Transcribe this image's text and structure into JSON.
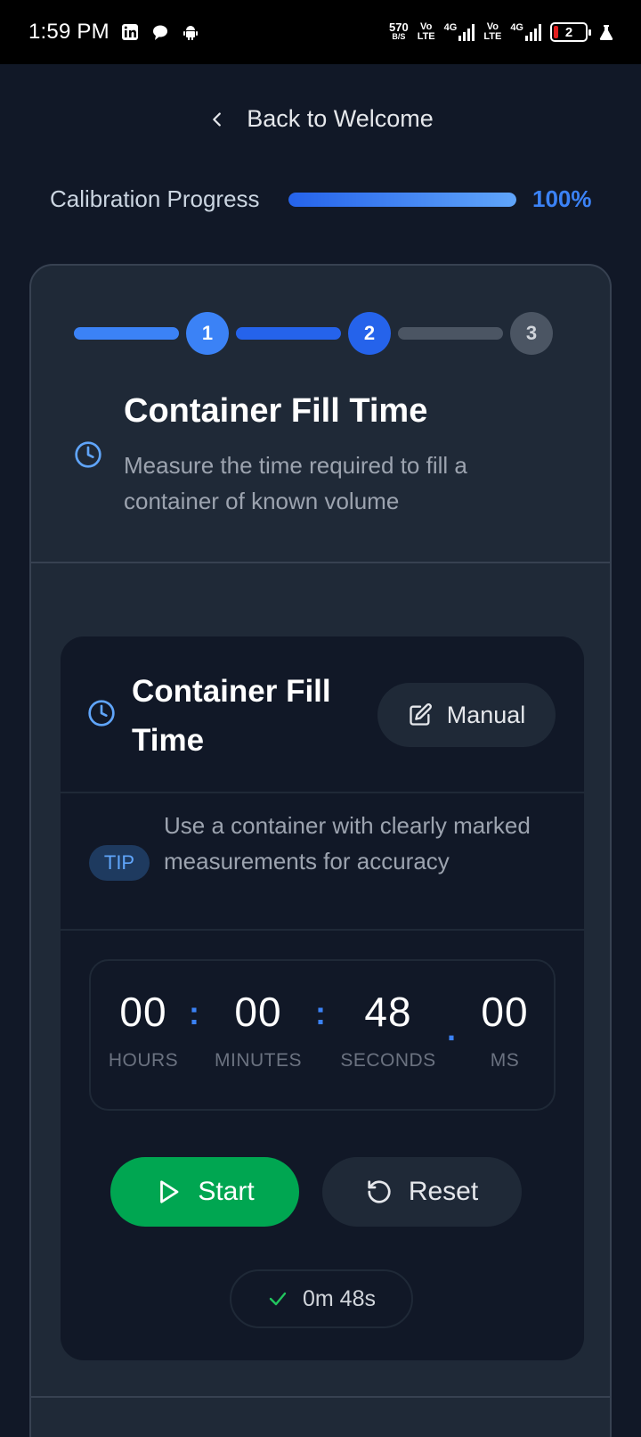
{
  "status_bar": {
    "time": "1:59 PM",
    "net_speed_value": "570",
    "net_speed_unit": "B/S",
    "sim1_top": "Vo",
    "sim1_bottom": "LTE",
    "sim1_net": "4G",
    "sim2_top": "Vo",
    "sim2_bottom": "LTE",
    "sim2_net": "4G",
    "battery_level": "2"
  },
  "nav": {
    "back_label": "Back to Welcome"
  },
  "progress": {
    "label": "Calibration Progress",
    "percent_text": "100%",
    "fraction": 1.0
  },
  "steps": [
    "1",
    "2",
    "3"
  ],
  "header": {
    "title": "Container Fill Time",
    "description": "Measure the time required to fill a container of known volume"
  },
  "timer_card": {
    "title": "Container Fill Time",
    "manual_label": "Manual",
    "tip_badge": "TIP",
    "tip_text": "Use a container with clearly marked measurements for accuracy",
    "hours": "00",
    "hours_label": "HOURS",
    "minutes": "00",
    "minutes_label": "MINUTES",
    "seconds": "48",
    "seconds_label": "SECONDS",
    "ms": "00",
    "ms_label": "MS",
    "sep_colon": ":",
    "sep_dot": ".",
    "start_label": "Start",
    "reset_label": "Reset",
    "result": "0m 48s"
  },
  "colors": {
    "accent": "#3b82f6",
    "start": "#00a651",
    "background": "#111827",
    "card": "#1f2937"
  }
}
